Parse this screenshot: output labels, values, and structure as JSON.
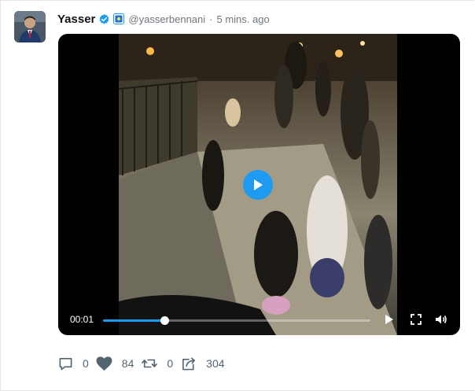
{
  "author": {
    "name": "Yasser",
    "handle": "@yasserbennani",
    "separator": "·",
    "time_ago": "5 mins. ago"
  },
  "video": {
    "current_time": "00:01",
    "progress_fraction": 0.23,
    "play_icon": "play-icon",
    "fullscreen_icon": "fullscreen-icon",
    "volume_icon": "volume-icon"
  },
  "actions": {
    "replies": "0",
    "likes": "84",
    "retweets": "0",
    "shares": "304"
  },
  "colors": {
    "accent": "#1d9bf0",
    "verified": "#1d9bf0",
    "text_muted": "#536471"
  }
}
